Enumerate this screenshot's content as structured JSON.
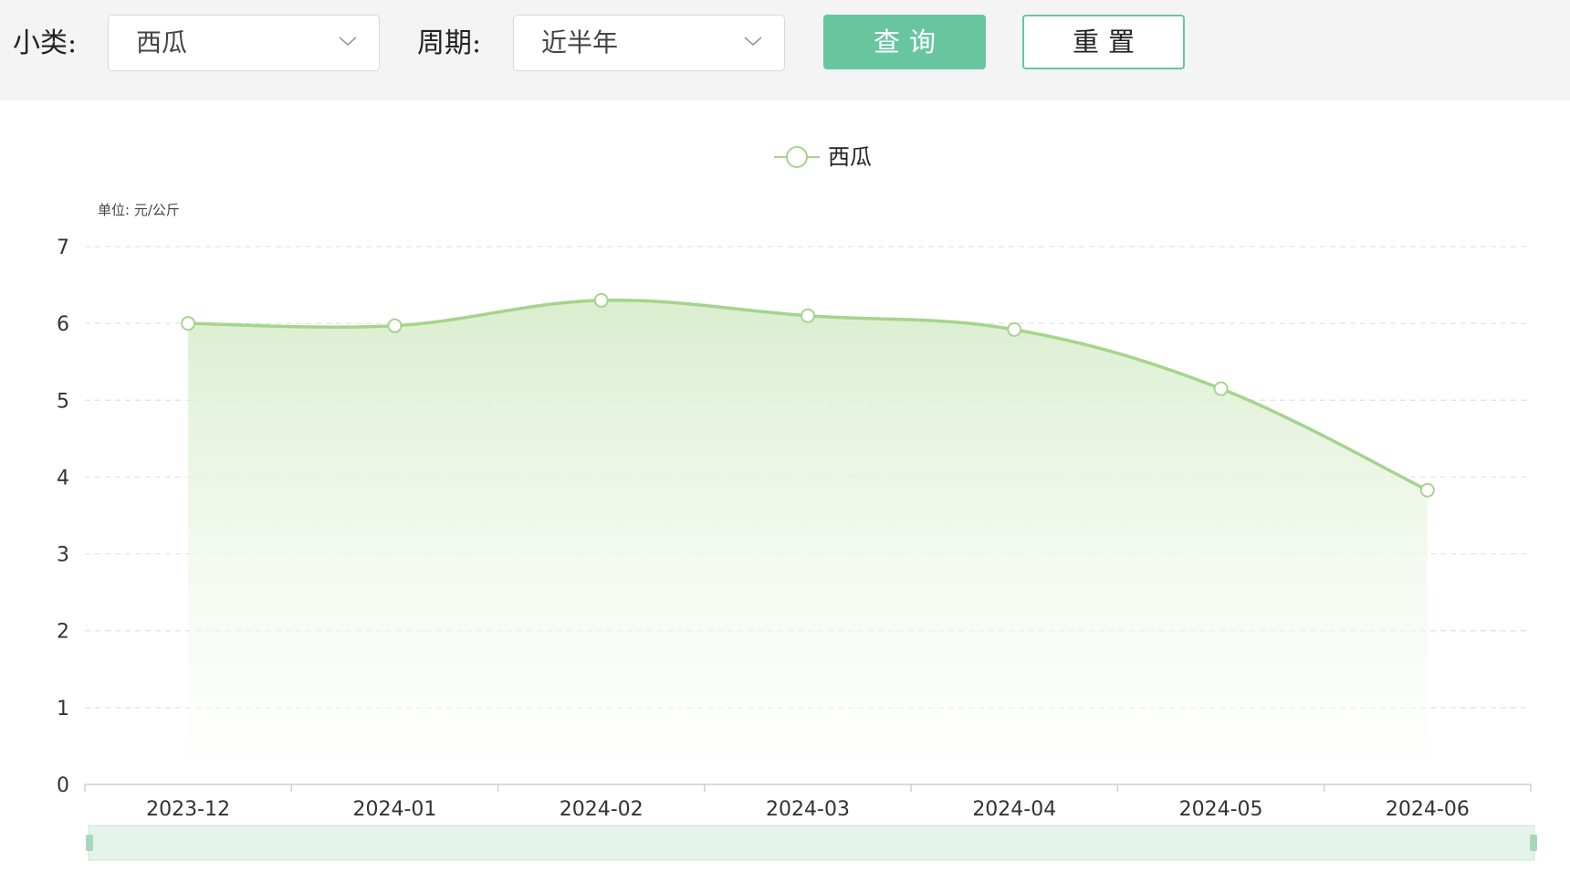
{
  "filters": {
    "category_label": "小类:",
    "category_value": "西瓜",
    "period_label": "周期:",
    "period_value": "近半年",
    "query_button": "查询",
    "reset_button": "重置"
  },
  "colors": {
    "accent": "#67c6a0",
    "series_line": "#a5d48c",
    "area_top": "#d8edcc",
    "grid": "#e3e3e3"
  },
  "chart_data": {
    "type": "line",
    "area_fill": true,
    "smooth": true,
    "x": [
      "2023-12",
      "2024-01",
      "2024-02",
      "2024-03",
      "2024-04",
      "2024-05",
      "2024-06"
    ],
    "series": [
      {
        "name": "西瓜",
        "values": [
          6.0,
          5.97,
          6.3,
          6.1,
          5.92,
          5.15,
          3.83
        ]
      }
    ],
    "unit_label": "单位: 元/公斤",
    "ylim": [
      0,
      7
    ],
    "yticks": [
      0,
      1,
      2,
      3,
      4,
      5,
      6,
      7
    ],
    "grid": "horizontal-dashed",
    "legend_position": "top-center",
    "data_zoom": true
  }
}
